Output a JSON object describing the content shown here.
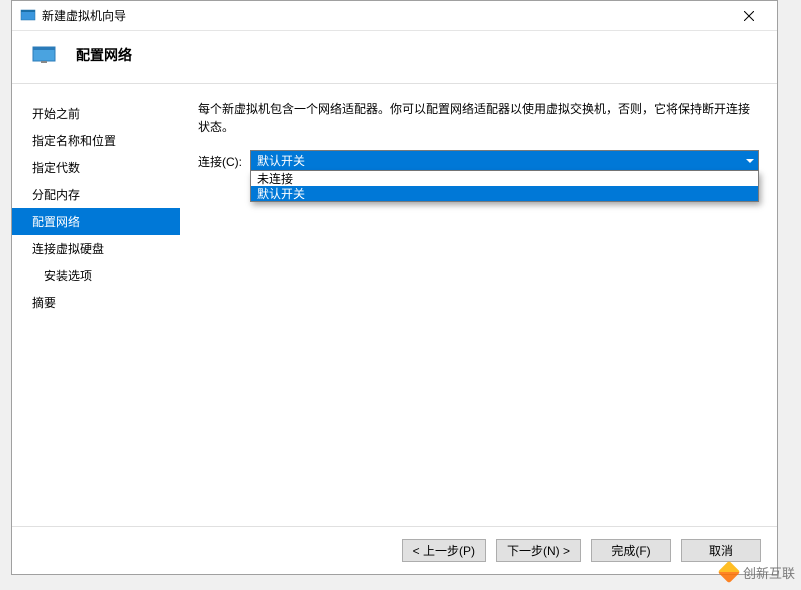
{
  "titlebar": {
    "title": "新建虚拟机向导"
  },
  "header": {
    "title": "配置网络"
  },
  "sidebar": {
    "items": [
      {
        "label": "开始之前",
        "selected": false,
        "indented": false
      },
      {
        "label": "指定名称和位置",
        "selected": false,
        "indented": false
      },
      {
        "label": "指定代数",
        "selected": false,
        "indented": false
      },
      {
        "label": "分配内存",
        "selected": false,
        "indented": false
      },
      {
        "label": "配置网络",
        "selected": true,
        "indented": false
      },
      {
        "label": "连接虚拟硬盘",
        "selected": false,
        "indented": false
      },
      {
        "label": "安装选项",
        "selected": false,
        "indented": true
      },
      {
        "label": "摘要",
        "selected": false,
        "indented": false
      }
    ]
  },
  "main": {
    "description": "每个新虚拟机包含一个网络适配器。你可以配置网络适配器以使用虚拟交换机，否则，它将保持断开连接状态。",
    "connection_label": "连接(C):",
    "combo": {
      "selected": "默认开关",
      "options": [
        {
          "label": "未连接",
          "highlighted": false
        },
        {
          "label": "默认开关",
          "highlighted": true
        }
      ]
    }
  },
  "buttons": {
    "prev": "< 上一步(P)",
    "next": "下一步(N) >",
    "finish": "完成(F)",
    "cancel": "取消"
  },
  "watermark": {
    "text": "创新互联"
  }
}
